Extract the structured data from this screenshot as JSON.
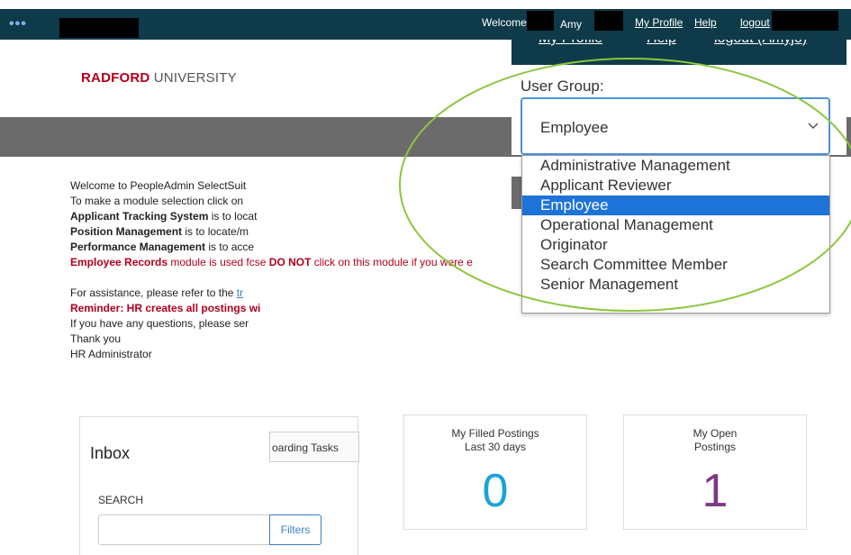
{
  "topbar": {
    "welcome": "Welcome",
    "user_name": "Amy",
    "my_profile": "My Profile",
    "help": "Help",
    "logout": "logout",
    "ghost_profile": "My Profile",
    "ghost_help": "Help",
    "ghost_logout": "logout (Amyjo)"
  },
  "brand": {
    "word_bold": "RADFORD",
    "word_rest": " UNIVERSITY"
  },
  "intro": {
    "line1": "Welcome to PeopleAdmin SelectSuit",
    "line2": "To make a module selection click on",
    "line3_bold": "Applicant Tracking System",
    "line3_rest": " is to locat",
    "line4_bold": "Position Management",
    "line4_rest": " is to locate/m",
    "line5_bold": "Performance Management",
    "line5_rest": " is to acce",
    "line6_red_bold": "Employee Records",
    "line6_red_a": " module is used fc",
    "line6_red_b": "se ",
    "line6_red_strong": "DO NOT",
    "line6_red_c": " click on this module if you were e",
    "assist_prefix": "For assistance, please refer to the ",
    "assist_link": "tr",
    "reminder": "Reminder: HR creates all postings wi",
    "questions": "If you have any questions, please ser",
    "thanks": "Thank you",
    "signature": "HR Administrator"
  },
  "inbox": {
    "title": "Inbox",
    "tab_label": "oarding Tasks",
    "search_label": "SEARCH",
    "search_value": "",
    "filters_label": "Filters"
  },
  "cards": [
    {
      "title": "My Filled Postings",
      "subtitle": "Last 30 days",
      "count": "0",
      "color": "#1aa3d6"
    },
    {
      "title": "My Open",
      "subtitle": "Postings",
      "count": "1",
      "color": "#7a3a82"
    }
  ],
  "user_group": {
    "label": "User Group:",
    "selected": "Employee",
    "options": [
      "Administrative Management",
      "Applicant Reviewer",
      "Employee",
      "Operational Management",
      "Originator",
      "Search Committee Member",
      "Senior Management"
    ],
    "highlight_color": "#1e73d8",
    "annotation_color": "#8cc63f"
  },
  "colors": {
    "topbar": "#0f3a4a",
    "brand_red": "#b1001c",
    "gray_band": "#6b6b6b",
    "link_blue": "#3a7fc1"
  }
}
